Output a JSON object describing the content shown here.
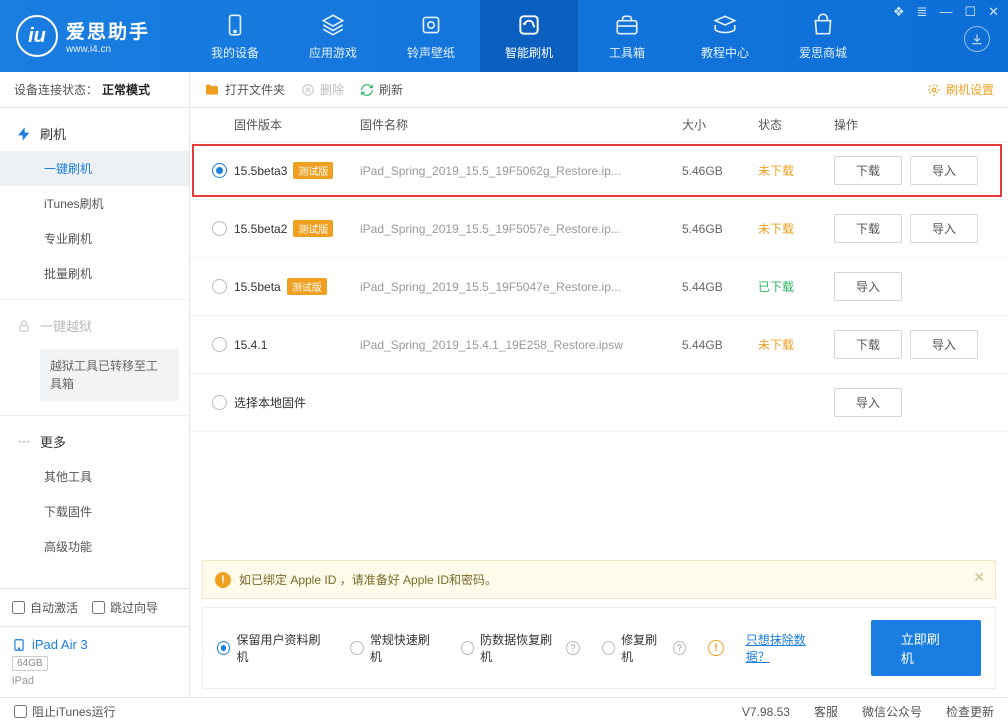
{
  "window": {
    "controls": [
      "❖",
      "≡",
      "—",
      "☐",
      "✕"
    ]
  },
  "header": {
    "brand": "爱思助手",
    "url": "www.i4.cn",
    "tabs": [
      {
        "id": "my-device",
        "label": "我的设备"
      },
      {
        "id": "apps",
        "label": "应用游戏"
      },
      {
        "id": "ringtones",
        "label": "铃声壁纸"
      },
      {
        "id": "flash",
        "label": "智能刷机",
        "active": true
      },
      {
        "id": "toolbox",
        "label": "工具箱"
      },
      {
        "id": "tutorial",
        "label": "教程中心"
      },
      {
        "id": "store",
        "label": "爱思商城"
      }
    ]
  },
  "sidebar": {
    "conn_label": "设备连接状态：",
    "conn_value": "正常模式",
    "flash_group": "刷机",
    "flash_items": [
      "一键刷机",
      "iTunes刷机",
      "专业刷机",
      "批量刷机"
    ],
    "jailbreak": "一键越狱",
    "jailbreak_notice": "越狱工具已转移至工具箱",
    "more_group": "更多",
    "more_items": [
      "其他工具",
      "下载固件",
      "高级功能"
    ],
    "auto_activate": "自动激活",
    "skip_guide": "跳过向导",
    "device": {
      "name": "iPad Air 3",
      "storage": "64GB",
      "type": "iPad"
    }
  },
  "toolbar": {
    "open_folder": "打开文件夹",
    "delete": "删除",
    "refresh": "刷新",
    "settings": "刷机设置"
  },
  "table": {
    "headers": {
      "version": "固件版本",
      "name": "固件名称",
      "size": "大小",
      "status": "状态",
      "ops": "操作"
    },
    "download_btn": "下载",
    "import_btn": "导入",
    "local_label": "选择本地固件",
    "rows": [
      {
        "version": "15.5beta3",
        "beta": true,
        "name": "iPad_Spring_2019_15.5_19F5062g_Restore.ip...",
        "size": "5.46GB",
        "status": "未下载",
        "status_class": "und",
        "selected": true,
        "highlight": true,
        "show_dl": true
      },
      {
        "version": "15.5beta2",
        "beta": true,
        "name": "iPad_Spring_2019_15.5_19F5057e_Restore.ip...",
        "size": "5.46GB",
        "status": "未下载",
        "status_class": "und",
        "selected": false,
        "highlight": false,
        "show_dl": true
      },
      {
        "version": "15.5beta",
        "beta": true,
        "name": "iPad_Spring_2019_15.5_19F5047e_Restore.ip...",
        "size": "5.44GB",
        "status": "已下载",
        "status_class": "done",
        "selected": false,
        "highlight": false,
        "show_dl": false
      },
      {
        "version": "15.4.1",
        "beta": false,
        "name": "iPad_Spring_2019_15.4.1_19E258_Restore.ipsw",
        "size": "5.44GB",
        "status": "未下载",
        "status_class": "und",
        "selected": false,
        "highlight": false,
        "show_dl": true
      }
    ]
  },
  "notice": "如已绑定 Apple ID ，请准备好 Apple ID和密码。",
  "flash_options": {
    "opts": [
      {
        "label": "保留用户资料刷机",
        "selected": true
      },
      {
        "label": "常规快速刷机",
        "selected": false
      },
      {
        "label": "防数据恢复刷机",
        "selected": false,
        "help": true
      },
      {
        "label": "修复刷机",
        "selected": false,
        "help": true
      }
    ],
    "erase_link": "只想抹除数据？",
    "flash_btn": "立即刷机"
  },
  "statusbar": {
    "block_itunes": "阻止iTunes运行",
    "version": "V7.98.53",
    "support": "客服",
    "wechat": "微信公众号",
    "update": "检查更新"
  }
}
